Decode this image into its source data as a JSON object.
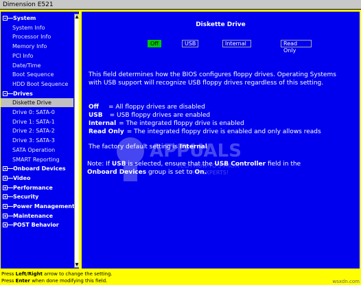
{
  "window": {
    "title": "Dimension E521"
  },
  "tree": [
    {
      "label": "System",
      "kind": "cat",
      "box": "minus"
    },
    {
      "label": "System Info",
      "kind": "sub"
    },
    {
      "label": "Processor Info",
      "kind": "sub"
    },
    {
      "label": "Memory Info",
      "kind": "sub"
    },
    {
      "label": "PCI Info",
      "kind": "sub"
    },
    {
      "label": "Date/Time",
      "kind": "sub"
    },
    {
      "label": "Boot Sequence",
      "kind": "sub"
    },
    {
      "label": "HDD Boot Sequence",
      "kind": "sub"
    },
    {
      "label": "Drives",
      "kind": "cat",
      "box": "minus"
    },
    {
      "label": "Diskette Drive",
      "kind": "sub",
      "selected": true
    },
    {
      "label": "Drive 0: SATA-0",
      "kind": "sub"
    },
    {
      "label": "Drive 1: SATA-1",
      "kind": "sub"
    },
    {
      "label": "Drive 2: SATA-2",
      "kind": "sub"
    },
    {
      "label": "Drive 3: SATA-3",
      "kind": "sub"
    },
    {
      "label": "SATA Operation",
      "kind": "sub"
    },
    {
      "label": "SMART Reporting",
      "kind": "sub"
    },
    {
      "label": "Onboard Devices",
      "kind": "cat",
      "box": "plus"
    },
    {
      "label": "Video",
      "kind": "cat",
      "box": "plus"
    },
    {
      "label": "Performance",
      "kind": "cat",
      "box": "plus"
    },
    {
      "label": "Security",
      "kind": "cat",
      "box": "plus"
    },
    {
      "label": "Power Management",
      "kind": "cat",
      "box": "plus"
    },
    {
      "label": "Maintenance",
      "kind": "cat",
      "box": "plus"
    },
    {
      "label": "POST Behavior",
      "kind": "cat",
      "box": "plus"
    }
  ],
  "main": {
    "heading": "Diskette Drive",
    "options": [
      {
        "label": "Off",
        "selected": true
      },
      {
        "label": "USB",
        "selected": false
      },
      {
        "label": "Internal",
        "selected": false
      },
      {
        "label": "Read Only",
        "selected": false
      }
    ],
    "description": "This field determines how the BIOS configures floppy drives. Operating Systems with USB support will recognize USB floppy drives regardless of this setting.",
    "defs": [
      {
        "term": "Off",
        "text": "= All floppy drives are disabled"
      },
      {
        "term": "USB",
        "text": "= USB floppy drives are enabled"
      },
      {
        "term": "Internal",
        "text": "= The integrated floppy drive is enabled"
      },
      {
        "term": "Read Only",
        "text": "= The integrated floppy drive is enabled and only allows reads"
      }
    ],
    "default_prefix": "The factory default setting is ",
    "default_value": "Internal",
    "note": {
      "p1": "Note: If ",
      "b1": "USB",
      "p2": " is selected, ensure that the ",
      "b2": "USB Controller",
      "p3": " field in the",
      "b3": "Onboard Devices",
      "p4": " group is set to ",
      "b4": "On."
    }
  },
  "footer": {
    "line1_pre": "Press ",
    "line1_key": "Left/Right",
    "line1_post": " arrow to change the setting.",
    "line2_pre": "Press ",
    "line2_key": "Enter",
    "line2_post": " when done modifying this field."
  },
  "watermark": {
    "text": "wsxdn.com"
  },
  "logo_watermark": {
    "brand": "APPUALS",
    "tagline1": "TECH HOW-TO'S FROM",
    "tagline2": "THE EXPERTS!"
  },
  "colors": {
    "bg": "#0000ee",
    "frame": "#ffff00",
    "selected_option": "#00c800",
    "selected_node": "#c0c0c0"
  }
}
